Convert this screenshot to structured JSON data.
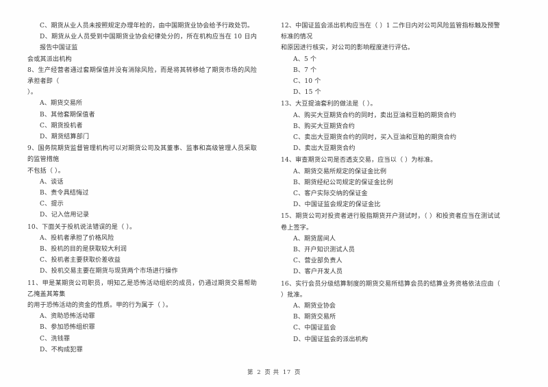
{
  "document": {
    "type": "exam-paper",
    "language": "zh-CN",
    "footer": {
      "page_prefix": "第",
      "page_number": "2",
      "page_middle": "页  共",
      "total_pages": "17",
      "page_suffix": "页",
      "full_text": "第 2 页 共 17 页"
    }
  },
  "left_column": {
    "carryover_options": [
      {
        "label": "C、期货从业人员未按照规定办理年检的，由中国期货业协会给予行政处罚。"
      },
      {
        "label": "D、期货从业人员受到中国期货业协会纪律处分的，所在机构应当在 10 日内报告中国证监",
        "continuation": "会或其派出机构"
      }
    ],
    "questions": [
      {
        "number": "8",
        "stem": "8、生产经营者通过套期保值并没有消除风险，而是将其转移给了期货市场的风险承担者即（",
        "stem_continuation": "）。",
        "options": [
          "A、期货交易所",
          "B、其他套期保值者",
          "C、期货投机者",
          "D、期货结算部门"
        ]
      },
      {
        "number": "9",
        "stem": "9、国务院期货监督管理机构可以对期货公司及其董事、监事和高级管理人员采取的监管措施",
        "stem_continuation": "不包括（      ）。",
        "options": [
          "A、谈话",
          "B、责令具结悔过",
          "C、提示",
          "D、记入信用记录"
        ]
      },
      {
        "number": "10",
        "stem": "10、下面关于投机说法错误的是（      ）。",
        "stem_continuation": "",
        "options": [
          "A、投机者承担了价格风险",
          "B、投机的目的是获取较大利润",
          "C、投机者主要获取价差收益",
          "D、投机交易主要在期货与现货两个市场进行操作"
        ]
      },
      {
        "number": "11",
        "stem": "11、甲是某期货公司职员，明知乙是恐怖活动组织的成员，仍通过期货交易帮助乙掩盖其筹集",
        "stem_continuation": "的用于恐怖活动的资金的性质。甲的行为属于（      ）。",
        "options": [
          "A、资助恐怖活动罪",
          "B、参加恐怖组织罪",
          "C、洗钱罪",
          "D、不构成犯罪"
        ]
      }
    ]
  },
  "right_column": {
    "questions": [
      {
        "number": "12",
        "stem": "12、中国证监会派出机构应当在（      ）1 二作日内对公司风险监管指标触及预警标准的情况",
        "stem_continuation": "和原因进行核实，对公司的影响程度进行评估。",
        "options": [
          "A、5 个",
          "B、7 个",
          "C、10 个",
          "D、15 个"
        ]
      },
      {
        "number": "13",
        "stem": "13、大豆提油套利的做法是（      ）。",
        "stem_continuation": "",
        "options": [
          "A、购买大豆期货合约的同时，卖出豆油和豆粕的期货合约",
          "B、购买大豆期货合约",
          "C、卖出大豆期货合约的同时，买入豆油和豆粕的期货合约",
          "D、卖出大豆期货合约"
        ]
      },
      {
        "number": "14",
        "stem": "14、审查期货公司是否透支交易，应当以（      ）为标准。",
        "stem_continuation": "",
        "options": [
          "A、期货交易所规定的保证金比例",
          "B、期货经纪公司规定的保证金比例",
          "C、客户实际交纳的保证金",
          "D、中国证监会规定的保证金比"
        ]
      },
      {
        "number": "15",
        "stem": "15、期货公司对投资者进行股指期货开户测试时，（      ）和投资者应当在测试试卷上签字。",
        "stem_continuation": "",
        "options": [
          "A、期货居间人",
          "B、开户知识测试人员",
          "C、营业部负责人",
          "D、客户开发人员"
        ]
      },
      {
        "number": "16",
        "stem": "16、实行会员分级结算制度的期货交易所结算会员的结算业务资格依法应由（      ）批准。",
        "stem_continuation": "",
        "options": [
          "A、期货业协会",
          "B、期货交易所",
          "C、中国证监会",
          "D、中国证监会的派出机构"
        ]
      }
    ]
  }
}
